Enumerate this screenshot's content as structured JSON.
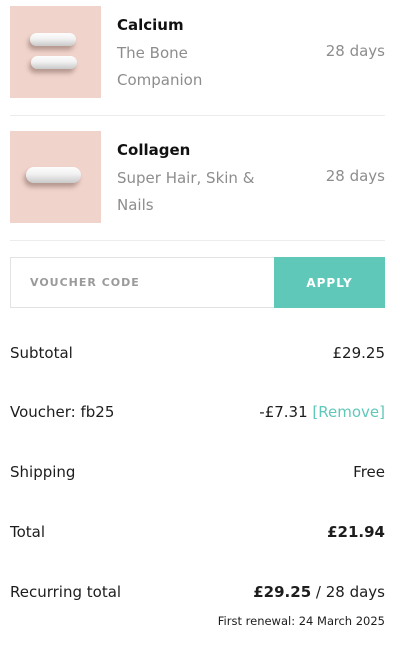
{
  "products": [
    {
      "name": "Calcium",
      "subtitle": "The Bone Companion",
      "duration": "28 days",
      "thumb_color": "#f0d4cc"
    },
    {
      "name": "Collagen",
      "subtitle": "Super Hair, Skin & Nails",
      "duration": "28 days",
      "thumb_color": "#f0d4cc"
    }
  ],
  "voucher": {
    "placeholder": "VOUCHER CODE",
    "value": "",
    "apply_label": "APPLY",
    "button_color": "#5fc8b9"
  },
  "summary": {
    "subtotal_label": "Subtotal",
    "subtotal_value": "£29.25",
    "voucher_label": "Voucher: fb25",
    "voucher_value": "-£7.31",
    "remove_label": "[Remove]",
    "shipping_label": "Shipping",
    "shipping_value": "Free",
    "total_label": "Total",
    "total_value": "£21.94",
    "recurring_label": "Recurring total",
    "recurring_amount": "£29.25",
    "recurring_period": " / 28 days",
    "renewal_text": "First renewal: 24 March 2025"
  }
}
